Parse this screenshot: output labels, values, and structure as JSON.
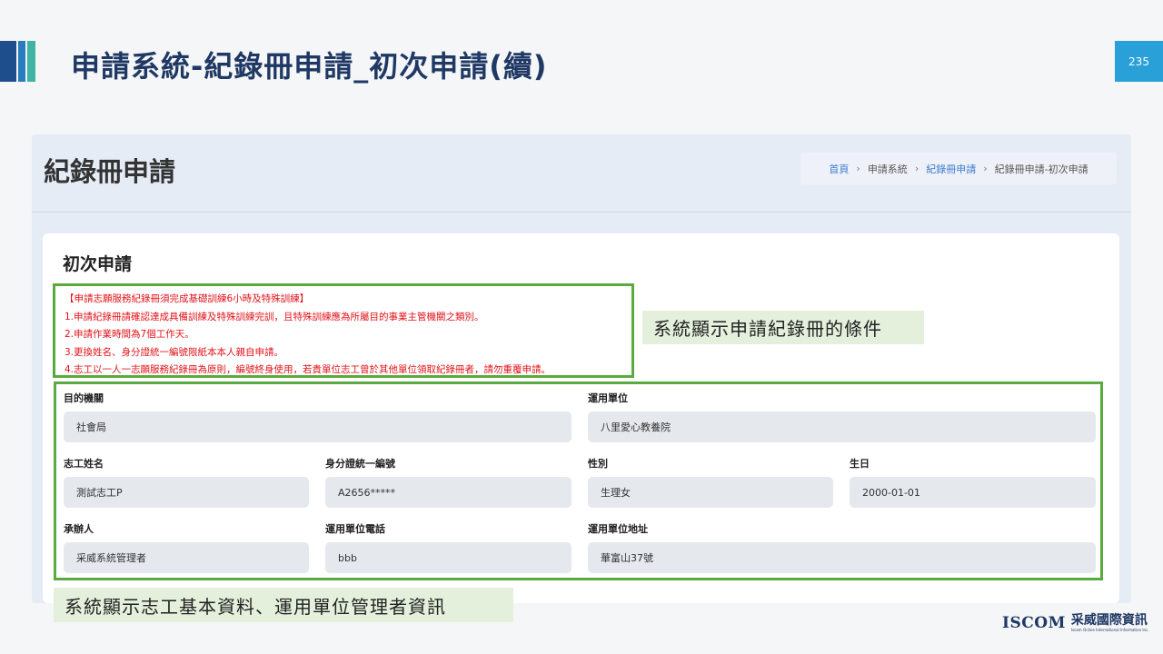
{
  "slide": {
    "title": "申請系統-紀錄冊申請_初次申請(續)",
    "page_number": "235"
  },
  "screenshot": {
    "page_title": "紀錄冊申請",
    "breadcrumb": [
      "首頁",
      "申請系統",
      "紀錄冊申請",
      "紀錄冊申請-初次申請"
    ],
    "card_title": "初次申請",
    "notice_lines": [
      "【申請志願服務紀錄冊須完成基礎訓練6小時及特殊訓練】",
      "1.申請紀錄冊請確認達成具備訓練及特殊訓練完訓，且特殊訓練應為所屬目的事業主管機關之類別。",
      "2.申請作業時間為7個工作天。",
      "3.更換姓名、身分證統一編號限紙本本人親自申請。",
      "4.志工以一人一志願服務紀錄冊為原則，編號終身使用，若貴單位志工曾於其他單位領取紀錄冊者，請勿重覆申請。"
    ],
    "fields": {
      "agency": {
        "label": "目的機關",
        "value": "社會局"
      },
      "unit": {
        "label": "運用單位",
        "value": "八里愛心教養院"
      },
      "volunteer_name": {
        "label": "志工姓名",
        "value": "測試志工P"
      },
      "id_number": {
        "label": "身分證統一編號",
        "value": "A2656*****"
      },
      "gender": {
        "label": "性別",
        "value": "生理女"
      },
      "birthday": {
        "label": "生日",
        "value": "2000-01-01"
      },
      "handler": {
        "label": "承辦人",
        "value": "采威系統管理者"
      },
      "unit_phone": {
        "label": "運用單位電話",
        "value": "bbb"
      },
      "unit_address": {
        "label": "運用單位地址",
        "value": "華富山37號"
      }
    }
  },
  "callouts": {
    "conditions": "系統顯示申請紀錄冊的條件",
    "basic_info": "系統顯示志工基本資料、運用單位管理者資訊"
  },
  "logo": {
    "en": "ISCOM",
    "zh": "采威國際資訊",
    "sub": "Iscom Online International Information Inc."
  },
  "colors": {
    "title": "#1f3864",
    "accent_blue": "#2aa0d8",
    "highlight_border": "#5aaa3f",
    "callout_bg": "#e4f0dc",
    "notice_text": "#e0131a"
  }
}
